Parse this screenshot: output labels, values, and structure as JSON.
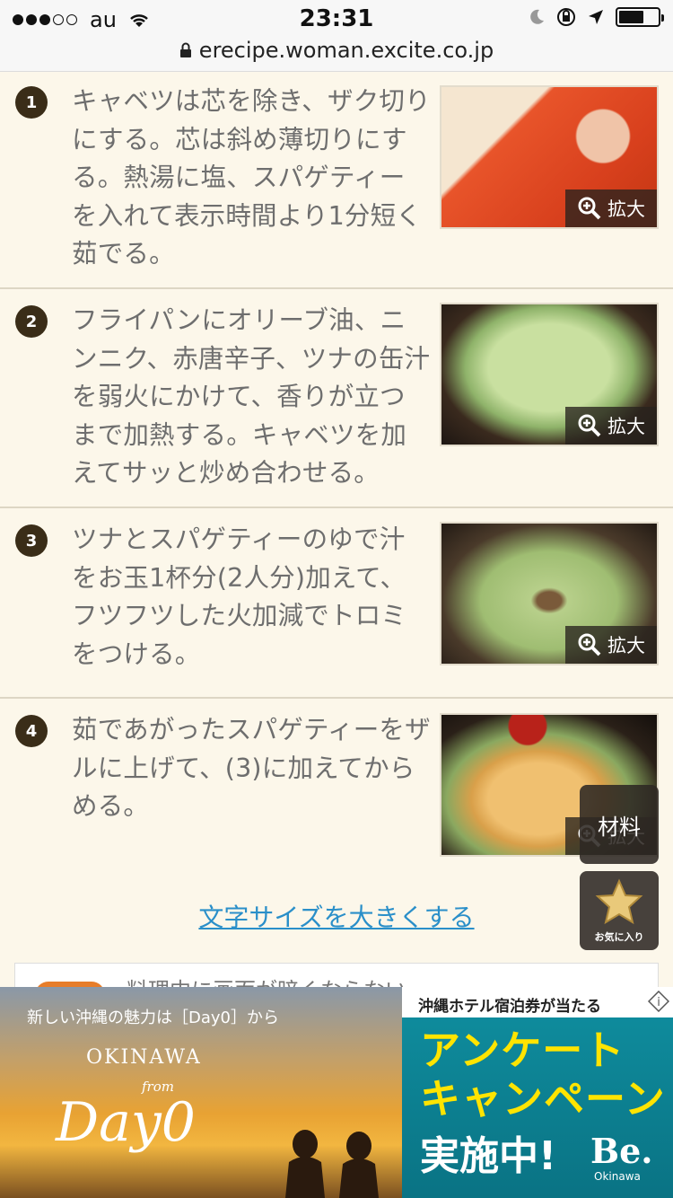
{
  "status_bar": {
    "carrier": "au",
    "time": "23:31",
    "url": "erecipe.woman.excite.co.jp",
    "battery_level": 0.65
  },
  "steps": [
    {
      "number": "1",
      "text": "キャベツは芯を除き、ザク切りにする。芯は斜め薄切りにする。熱湯に塩、スパゲティーを入れて表示時間より1分短く茹でる。",
      "zoom_label": "拡大"
    },
    {
      "number": "2",
      "text": "フライパンにオリーブ油、ニンニク、赤唐辛子、ツナの缶汁を弱火にかけて、香りが立つまで加熱する。キャベツを加えてサッと炒め合わせる。",
      "zoom_label": "拡大"
    },
    {
      "number": "3",
      "text": "ツナとスパゲティーのゆで汁をお玉1杯分(2人分)加えて、フツフツした火加減でトロミをつける。",
      "zoom_label": "拡大"
    },
    {
      "number": "4",
      "text": "茹であがったスパゲティーをザルに上げて、(3)に加えてからめる。",
      "zoom_label": "拡大"
    }
  ],
  "font_size_link": "文字サイズを大きくする",
  "floating": {
    "ingredients_label": "材料",
    "favorite_label": "お気に入り"
  },
  "notice": {
    "text": "料理中に画面が暗くならない"
  },
  "ad": {
    "left_top": "新しい沖縄の魅力は［Day0］から",
    "okinawa": "OKINAWA",
    "from": "from",
    "day": "Day0",
    "right_top": "沖縄ホテル宿泊券が当たる",
    "line1": "アンケート",
    "line2": "キャンペーン",
    "line3": "実施中!",
    "brand": "Be.",
    "brand_sub": "Okinawa"
  }
}
